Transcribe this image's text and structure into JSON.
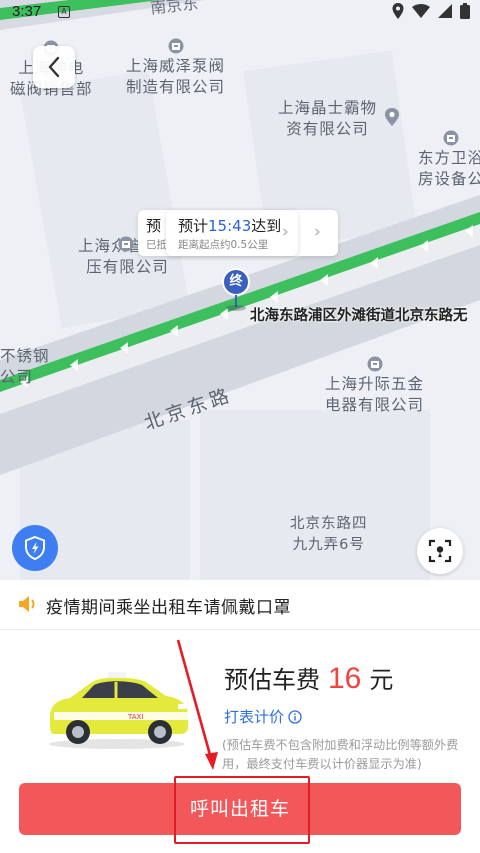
{
  "status_bar": {
    "time": "3:37",
    "notification": "A"
  },
  "map": {
    "pois": [
      {
        "name": "上海神电\n磁阀销售部"
      },
      {
        "name": "上海威泽泵阀\n制造有限公司"
      },
      {
        "name": "上海晶士霸物\n资有限公司"
      },
      {
        "name": "东方卫浴\n房设备公"
      },
      {
        "name": "上海众誉力液\n压有限公司"
      },
      {
        "name": "不锈钢\n公司"
      },
      {
        "name": "上海升际五金\n电器有限公司"
      },
      {
        "name": "北京东路四\n九九弄6号"
      }
    ],
    "top_road_label": "南京东",
    "road_name": "北京东路",
    "eta": {
      "ghost_title": "预",
      "ghost_sub": "已抵",
      "prefix": "预计",
      "time": "15:43",
      "suffix": "达到",
      "distance": "距离起点约0.5公里"
    },
    "end_marker": "终",
    "destination_label": "北海东路浦区外滩街道北京东路无"
  },
  "notice": {
    "text": "疫情期间乘坐出租车请佩戴口罩"
  },
  "fare": {
    "prefix": "预估车费",
    "amount": "16",
    "unit": "元",
    "meter_link": "打表计价",
    "note": "(预估车费不包含附加费和浮动比例等额外费用，最终支付车费以计价器显示为准)"
  },
  "call_button": {
    "label": "呼叫出租车"
  },
  "colors": {
    "accent_blue": "#3f7ef2",
    "button_red": "#f2585a",
    "fare_red": "#f0443c",
    "route_green": "#3dbf5e",
    "annotation_red": "#e51c23"
  }
}
